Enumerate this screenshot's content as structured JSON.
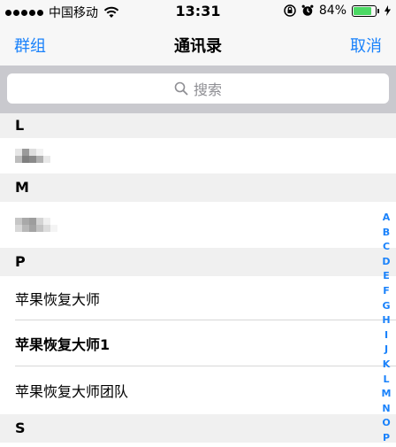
{
  "status_bar": {
    "carrier": "中国移动",
    "time": "13:31",
    "battery_percent": "84%",
    "battery_level": 0.84
  },
  "nav": {
    "left": "群组",
    "title": "通讯录",
    "right": "取消"
  },
  "search": {
    "placeholder": "搜索"
  },
  "sections": [
    {
      "letter": "L",
      "rows": [
        {
          "name": ""
        }
      ]
    },
    {
      "letter": "M",
      "rows": [
        {
          "name": ""
        }
      ]
    },
    {
      "letter": "P",
      "rows": [
        {
          "name": "苹果恢复大师"
        },
        {
          "name": "苹果恢复大师1"
        },
        {
          "name": "苹果恢复大师团队"
        }
      ]
    },
    {
      "letter": "S",
      "rows": []
    }
  ],
  "index": [
    "A",
    "B",
    "C",
    "D",
    "E",
    "F",
    "G",
    "H",
    "I",
    "J",
    "K",
    "L",
    "M",
    "N",
    "O",
    "P"
  ],
  "colors": {
    "accent": "#1a82fb",
    "section_bg": "#f0f0f0",
    "search_bg": "#c9c9ce",
    "battery": "#4cd964"
  }
}
